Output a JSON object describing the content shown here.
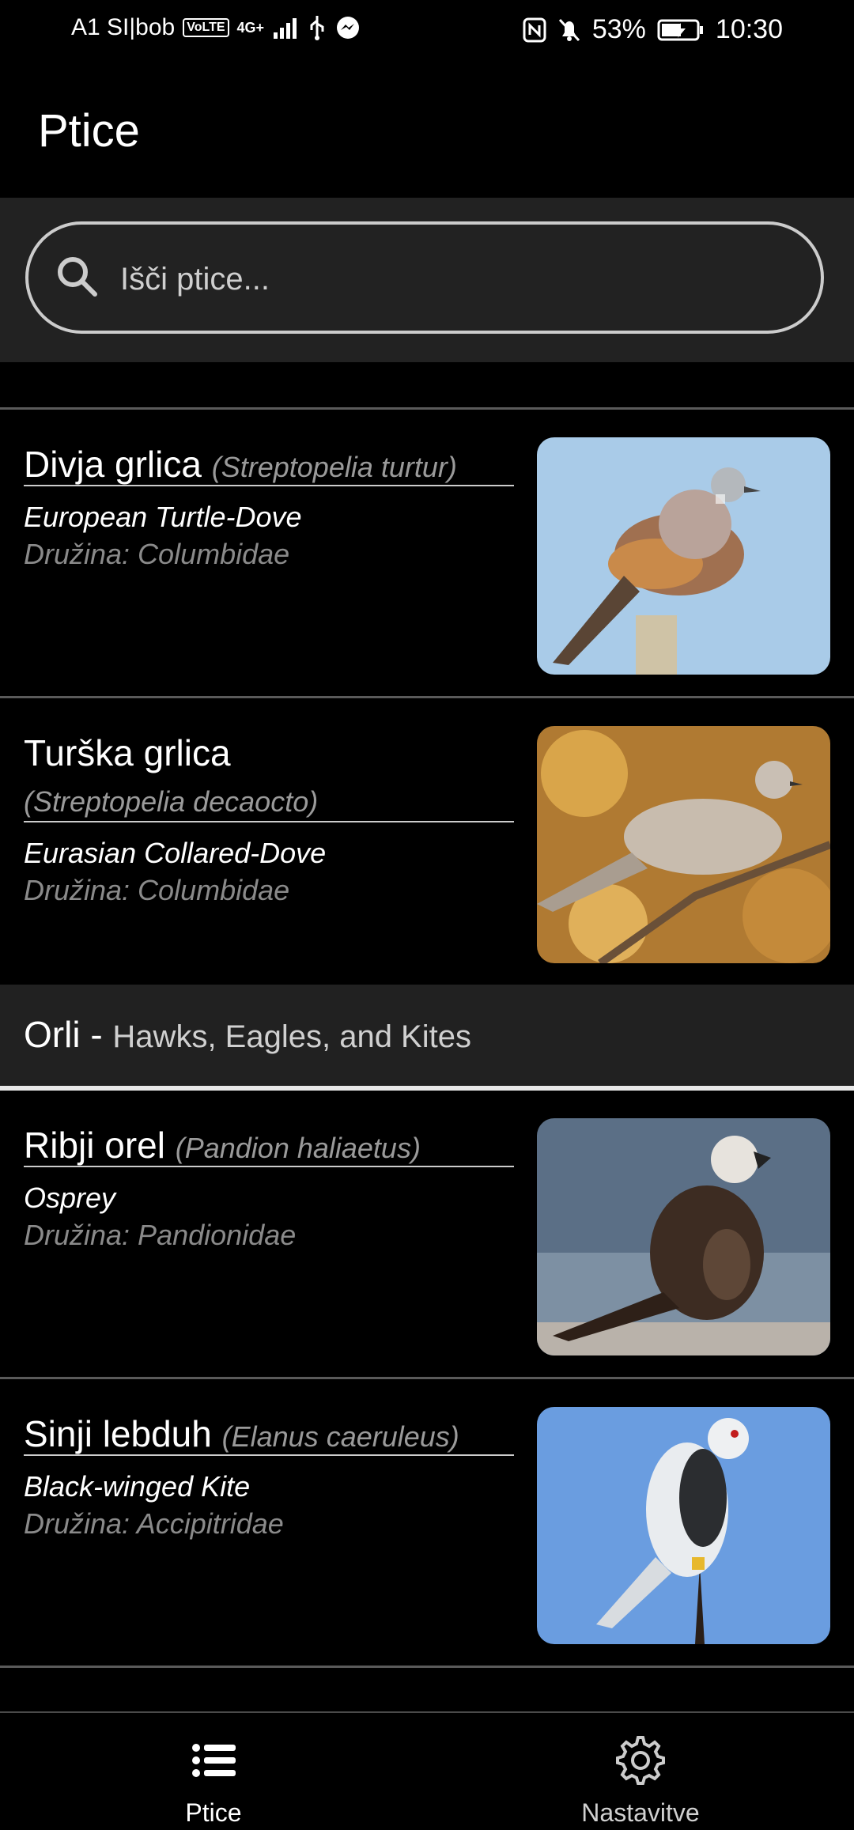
{
  "status": {
    "carrier": "A1 SI|bob",
    "volte": "VoLTE",
    "network": "4G+",
    "battery": "53%",
    "time": "10:30"
  },
  "header": {
    "title": "Ptice"
  },
  "search": {
    "placeholder": "Išči ptice..."
  },
  "items": [
    {
      "name": "Divja grlica",
      "scientific": "(Streptopelia turtur)",
      "common": "European Turtle-Dove",
      "family": "Družina: Columbidae"
    },
    {
      "name": "Turška grlica",
      "scientific": "(Streptopelia decaocto)",
      "common": "Eurasian Collared-Dove",
      "family": "Družina: Columbidae"
    },
    {
      "name": "Ribji orel",
      "scientific": "(Pandion haliaetus)",
      "common": "Osprey",
      "family": "Družina: Pandionidae"
    },
    {
      "name": "Sinji lebduh",
      "scientific": "(Elanus caeruleus)",
      "common": "Black-winged Kite",
      "family": "Družina: Accipitridae"
    }
  ],
  "section": {
    "label": "Orli - ",
    "sub": "Hawks, Eagles, and Kites"
  },
  "bottom_nav": [
    {
      "label": "Ptice",
      "icon": "list-icon"
    },
    {
      "label": "Nastavitve",
      "icon": "gear-icon"
    }
  ],
  "colors": {
    "background": "#000000",
    "search_bg": "#222222",
    "section_bg": "#212121"
  }
}
